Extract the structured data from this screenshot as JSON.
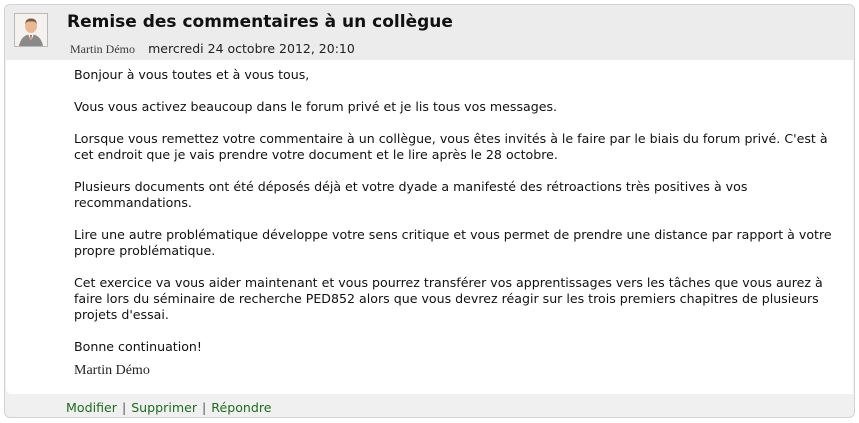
{
  "post": {
    "subject": "Remise des commentaires à un collègue",
    "author": "Martin Démo",
    "date": "mercredi 24 octobre 2012, 20:10",
    "avatar_icon": "user-avatar-icon",
    "paragraphs": [
      "Bonjour à vous toutes et à vous tous,",
      "Vous vous activez beaucoup dans le forum privé et je lis tous vos messages.",
      "Lorsque vous remettez votre commentaire à un collègue, vous êtes invités à le faire par le biais du forum privé. C'est à cet endroit que je vais prendre votre document et le lire après le 28 octobre.",
      "Plusieurs documents ont été déposés déjà et votre dyade a manifesté des rétroactions très positives à vos recommandations.",
      "Lire une autre problématique développe votre sens critique et vous permet de prendre une distance par rapport à votre propre problématique.",
      "Cet exercice va vous aider maintenant et vous pourrez transférer vos apprentissages vers les tâches que vous aurez à faire lors du séminaire de recherche PED852 alors que vous devrez réagir sur les trois premiers chapitres de plusieurs projets d'essai.",
      "Bonne continuation!"
    ],
    "signature": "Martin Démo"
  },
  "commands": {
    "edit": "Modifier",
    "delete": "Supprimer",
    "reply": "Répondre",
    "separator": "|"
  },
  "colors": {
    "link": "#1e6b1e",
    "header_bg": "#ececec",
    "border": "#d2d2d2"
  }
}
